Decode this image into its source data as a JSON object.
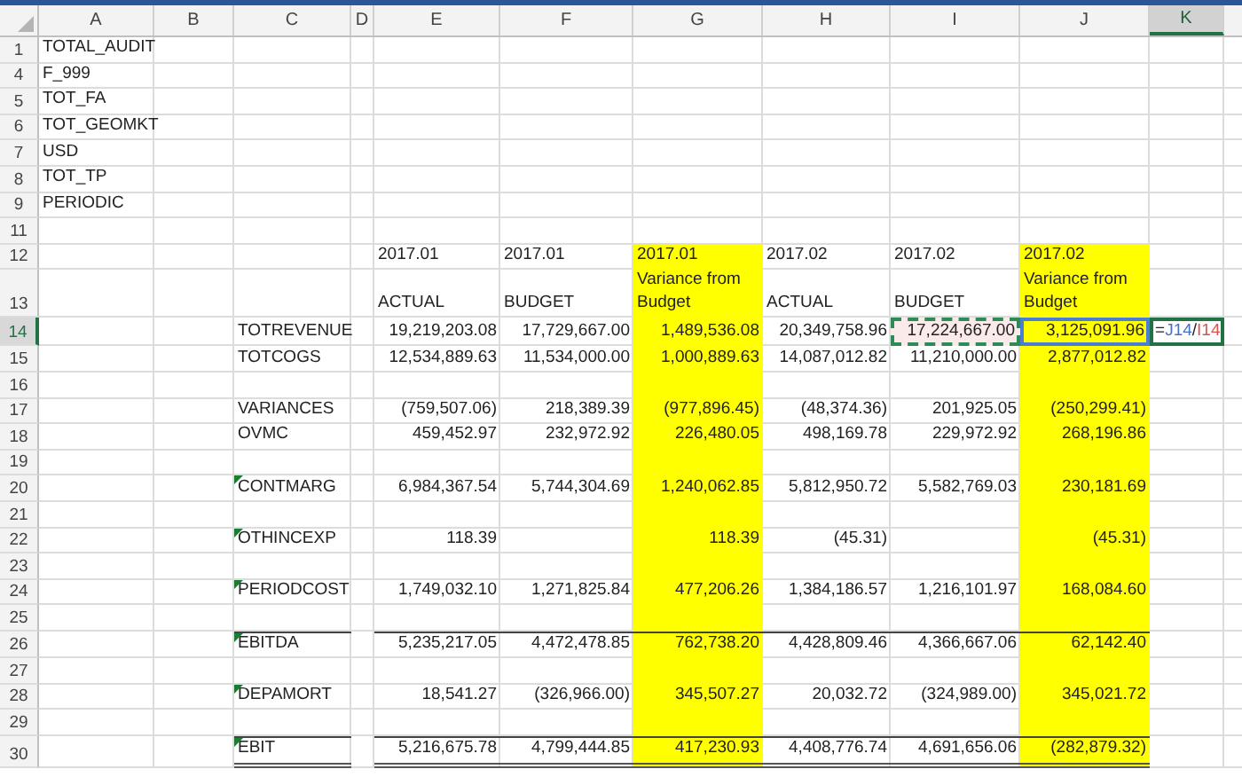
{
  "columns": [
    {
      "label": "A",
      "kind": "plain",
      "selected": false
    },
    {
      "label": "B",
      "kind": "plain",
      "selected": false
    },
    {
      "label": "C",
      "kind": "label",
      "selected": false
    },
    {
      "label": "D",
      "kind": "plain",
      "selected": false
    },
    {
      "label": "E",
      "kind": "value",
      "selected": false
    },
    {
      "label": "F",
      "kind": "value",
      "selected": false
    },
    {
      "label": "G",
      "kind": "value",
      "selected": false
    },
    {
      "label": "H",
      "kind": "value",
      "selected": false
    },
    {
      "label": "I",
      "kind": "value",
      "selected": false
    },
    {
      "label": "J",
      "kind": "value",
      "selected": false
    },
    {
      "label": "K",
      "kind": "plain",
      "selected": true
    }
  ],
  "rows": [
    {
      "number": "1",
      "kind": "label",
      "selected": false,
      "cells": [
        "TOTAL_AUDIT",
        null,
        null,
        null,
        null,
        null,
        null,
        null,
        null,
        null,
        null
      ]
    },
    {
      "number": "4",
      "kind": "label",
      "selected": false,
      "cells": [
        "F_999",
        null,
        null,
        null,
        null,
        null,
        null,
        null,
        null,
        null,
        null
      ]
    },
    {
      "number": "5",
      "kind": "label",
      "selected": false,
      "cells": [
        "TOT_FA",
        null,
        null,
        null,
        null,
        null,
        null,
        null,
        null,
        null,
        null
      ]
    },
    {
      "number": "6",
      "kind": "label",
      "selected": false,
      "cells": [
        "TOT_GEOMKT",
        null,
        null,
        null,
        null,
        null,
        null,
        null,
        null,
        null,
        null
      ]
    },
    {
      "number": "7",
      "kind": "label",
      "selected": false,
      "cells": [
        "USD",
        null,
        null,
        null,
        null,
        null,
        null,
        null,
        null,
        null,
        null
      ]
    },
    {
      "number": "8",
      "kind": "label",
      "selected": false,
      "cells": [
        "TOT_TP",
        null,
        null,
        null,
        null,
        null,
        null,
        null,
        null,
        null,
        null
      ]
    },
    {
      "number": "9",
      "kind": "label",
      "selected": false,
      "cells": [
        "PERIODIC",
        null,
        null,
        null,
        null,
        null,
        null,
        null,
        null,
        null,
        null
      ]
    },
    {
      "number": "11",
      "kind": "blank",
      "selected": false,
      "cells": [
        null,
        null,
        null,
        null,
        null,
        null,
        null,
        null,
        null,
        null,
        null
      ]
    },
    {
      "number": "12",
      "kind": "header",
      "selected": false,
      "cells": [
        null,
        null,
        null,
        null,
        "2017.01",
        "2017.01",
        {
          "text": "2017.01",
          "highlighted": true
        },
        "2017.02",
        "2017.02",
        {
          "text": "2017.02",
          "highlighted": true
        },
        null
      ]
    },
    {
      "number": "13",
      "kind": "header",
      "selected": false,
      "cells": [
        null,
        null,
        null,
        null,
        "ACTUAL",
        "BUDGET",
        {
          "text": "Variance from Budget",
          "highlighted": true
        },
        "ACTUAL",
        "BUDGET",
        {
          "text": "Variance from Budget",
          "highlighted": true
        },
        null
      ]
    },
    {
      "number": "14",
      "kind": "values",
      "selected": true,
      "cells": [
        null,
        null,
        "TOTREVENUE",
        null,
        "19,219,203.08",
        "17,729,667.00",
        {
          "text": "1,489,536.08",
          "highlighted": true
        },
        "20,349,758.96",
        {
          "text": "17,224,667.00",
          "kind": "marquee"
        },
        {
          "text": "3,125,091.96",
          "kind": "reference",
          "highlighted": true
        },
        {
          "kind": "editing",
          "formula": [
            {
              "text": "="
            },
            {
              "text": "J14",
              "color": "#4472c4"
            },
            {
              "text": "/"
            },
            {
              "text": "I14",
              "color": "#d9534f"
            }
          ]
        }
      ]
    },
    {
      "number": "15",
      "kind": "values",
      "selected": false,
      "cells": [
        null,
        null,
        "TOTCOGS",
        null,
        "12,534,889.63",
        "11,534,000.00",
        {
          "text": "1,000,889.63",
          "highlighted": true
        },
        "14,087,012.82",
        "11,210,000.00",
        {
          "text": "2,877,012.82",
          "highlighted": true
        },
        null
      ]
    },
    {
      "number": "16",
      "kind": "blank",
      "selected": false,
      "cells": [
        null,
        null,
        null,
        null,
        null,
        null,
        {
          "highlighted": true
        },
        null,
        null,
        {
          "highlighted": true
        },
        null
      ]
    },
    {
      "number": "17",
      "kind": "values",
      "selected": false,
      "cells": [
        null,
        null,
        "VARIANCES",
        null,
        "(759,507.06)",
        "218,389.39",
        {
          "text": "(977,896.45)",
          "highlighted": true
        },
        "(48,374.36)",
        "201,925.05",
        {
          "text": "(250,299.41)",
          "highlighted": true
        },
        null
      ]
    },
    {
      "number": "18",
      "kind": "values",
      "selected": false,
      "cells": [
        null,
        null,
        "OVMC",
        null,
        "459,452.97",
        "232,972.92",
        {
          "text": "226,480.05",
          "highlighted": true
        },
        "498,169.78",
        "229,972.92",
        {
          "text": "268,196.86",
          "highlighted": true
        },
        null
      ]
    },
    {
      "number": "19",
      "kind": "blank",
      "selected": false,
      "cells": [
        null,
        null,
        null,
        null,
        null,
        null,
        {
          "highlighted": true
        },
        null,
        null,
        {
          "highlighted": true
        },
        null
      ]
    },
    {
      "number": "20",
      "kind": "values",
      "selected": false,
      "cells": [
        null,
        null,
        {
          "text": "CONTMARG",
          "error_flag": true
        },
        null,
        "6,984,367.54",
        "5,744,304.69",
        {
          "text": "1,240,062.85",
          "highlighted": true
        },
        "5,812,950.72",
        "5,582,769.03",
        {
          "text": "230,181.69",
          "highlighted": true
        },
        null
      ]
    },
    {
      "number": "21",
      "kind": "blank",
      "selected": false,
      "cells": [
        null,
        null,
        null,
        null,
        null,
        null,
        {
          "highlighted": true
        },
        null,
        null,
        {
          "highlighted": true
        },
        null
      ]
    },
    {
      "number": "22",
      "kind": "values",
      "selected": false,
      "cells": [
        null,
        null,
        {
          "text": "OTHINCEXP",
          "error_flag": true
        },
        null,
        "118.39",
        null,
        {
          "text": "118.39",
          "highlighted": true
        },
        "(45.31)",
        null,
        {
          "text": "(45.31)",
          "highlighted": true
        },
        null
      ]
    },
    {
      "number": "23",
      "kind": "blank",
      "selected": false,
      "cells": [
        null,
        null,
        null,
        null,
        null,
        null,
        {
          "highlighted": true
        },
        null,
        null,
        {
          "highlighted": true
        },
        null
      ]
    },
    {
      "number": "24",
      "kind": "values",
      "selected": false,
      "cells": [
        null,
        null,
        {
          "text": "PERIODCOST",
          "error_flag": true
        },
        null,
        "1,749,032.10",
        "1,271,825.84",
        {
          "text": "477,206.26",
          "highlighted": true
        },
        "1,384,186.57",
        "1,216,101.97",
        {
          "text": "168,084.60",
          "highlighted": true
        },
        null
      ]
    },
    {
      "number": "25",
      "kind": "blank",
      "selected": false,
      "cells": [
        null,
        null,
        null,
        null,
        null,
        null,
        {
          "highlighted": true
        },
        null,
        null,
        {
          "highlighted": true
        },
        null
      ]
    },
    {
      "number": "26",
      "kind": "values",
      "selected": false,
      "top_border": true,
      "cells": [
        null,
        null,
        {
          "text": "EBITDA",
          "error_flag": true
        },
        null,
        "5,235,217.05",
        "4,472,478.85",
        {
          "text": "762,738.20",
          "highlighted": true
        },
        "4,428,809.46",
        "4,366,667.06",
        {
          "text": "62,142.40",
          "highlighted": true
        },
        null
      ]
    },
    {
      "number": "27",
      "kind": "blank",
      "selected": false,
      "cells": [
        null,
        null,
        null,
        null,
        null,
        null,
        {
          "highlighted": true
        },
        null,
        null,
        {
          "highlighted": true
        },
        null
      ]
    },
    {
      "number": "28",
      "kind": "values",
      "selected": false,
      "cells": [
        null,
        null,
        {
          "text": "DEPAMORT",
          "error_flag": true
        },
        null,
        "18,541.27",
        "(326,966.00)",
        {
          "text": "345,507.27",
          "highlighted": true
        },
        "20,032.72",
        "(324,989.00)",
        {
          "text": "345,021.72",
          "highlighted": true
        },
        null
      ]
    },
    {
      "number": "29",
      "kind": "blank",
      "selected": false,
      "cells": [
        null,
        null,
        null,
        null,
        null,
        null,
        {
          "highlighted": true
        },
        null,
        null,
        {
          "highlighted": true
        },
        null
      ]
    },
    {
      "number": "30",
      "kind": "values",
      "selected": false,
      "top_border": true,
      "double_underline": true,
      "cells": [
        null,
        null,
        {
          "text": "EBIT",
          "error_flag": true
        },
        null,
        "5,216,675.78",
        "4,799,444.85",
        {
          "text": "417,230.93",
          "highlighted": true
        },
        "4,408,776.74",
        "4,691,656.06",
        {
          "text": "(282,879.32)",
          "highlighted": true
        },
        null
      ]
    }
  ]
}
